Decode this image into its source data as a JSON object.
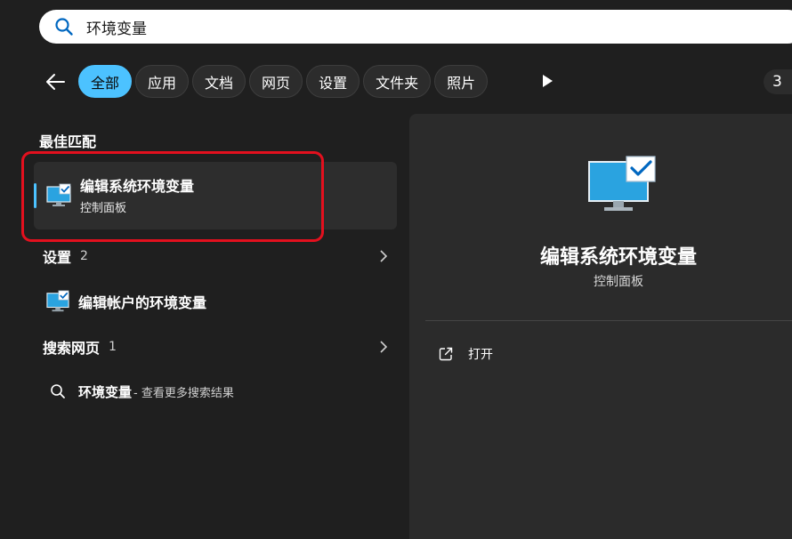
{
  "search": {
    "query": "环境变量"
  },
  "filters": {
    "tabs": [
      {
        "label": "全部",
        "active": true
      },
      {
        "label": "应用"
      },
      {
        "label": "文档"
      },
      {
        "label": "网页"
      },
      {
        "label": "设置"
      },
      {
        "label": "文件夹"
      },
      {
        "label": "照片"
      }
    ],
    "badge": "3"
  },
  "results": {
    "best_match": {
      "heading": "最佳匹配",
      "title": "编辑系统环境变量",
      "subtitle": "控制面板"
    },
    "settings_group": {
      "label": "设置",
      "count": "2"
    },
    "settings_item": {
      "label": "编辑帐户的环境变量"
    },
    "web_group": {
      "label": "搜索网页",
      "count": "1"
    },
    "web_item": {
      "query": "环境变量",
      "suffix": " - 查看更多搜索结果"
    }
  },
  "preview": {
    "title": "编辑系统环境变量",
    "subtitle": "控制面板",
    "action_open": "打开"
  },
  "colors": {
    "accent": "#4cc2ff",
    "highlight": "#e3101e",
    "background": "#1f1f1f",
    "panel": "#2b2b2b"
  },
  "icons": [
    "search-icon",
    "back-arrow-icon",
    "play-icon",
    "monitor-check-icon",
    "chevron-right-icon",
    "open-external-icon"
  ]
}
